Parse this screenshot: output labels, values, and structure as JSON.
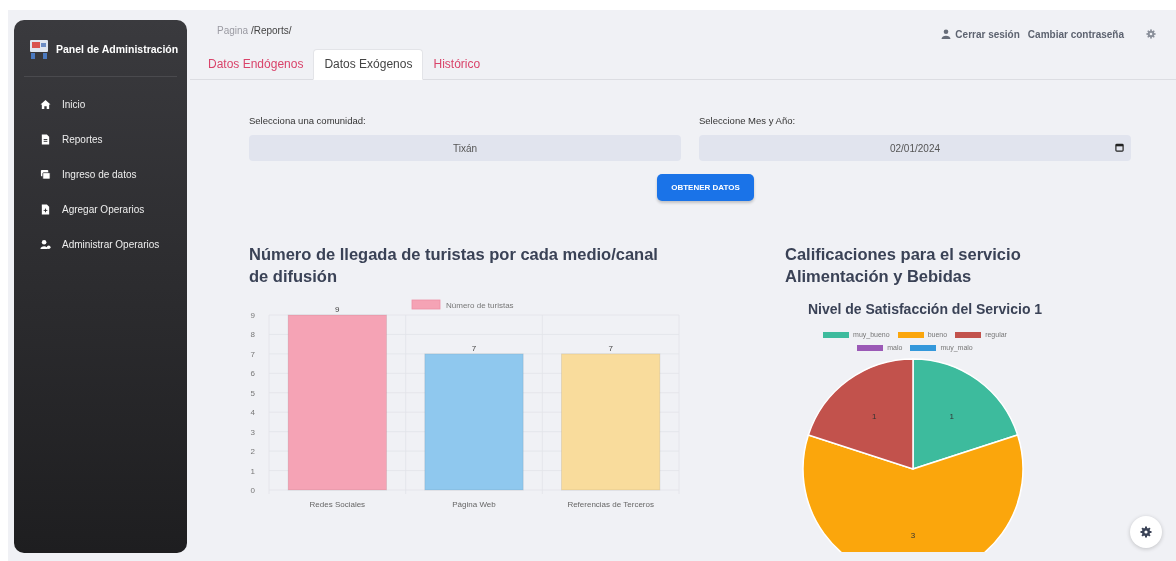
{
  "sidebar": {
    "title": "Panel de Administración",
    "items": [
      {
        "label": "Inicio",
        "kind": "home"
      },
      {
        "label": "Reportes",
        "kind": "file"
      },
      {
        "label": "Ingreso de datos",
        "kind": "stack"
      },
      {
        "label": "Agregar Operarios",
        "kind": "file-plus"
      },
      {
        "label": "Administrar Operarios",
        "kind": "users"
      }
    ]
  },
  "breadcrumb": {
    "prefix": "Pagina",
    "path": "/Reports/"
  },
  "header_links": [
    {
      "label": "Cerrar sesión",
      "kind": "user"
    },
    {
      "label": "Cambiar contraseña",
      "kind": "plain"
    }
  ],
  "tabs": [
    {
      "label": "Datos Endógenos",
      "selected": false
    },
    {
      "label": "Datos Exógenos",
      "selected": true
    },
    {
      "label": "Histórico",
      "selected": false
    }
  ],
  "form": {
    "fields": [
      {
        "label": "Selecciona una comunidad:",
        "value": "Tixán",
        "kind": "select"
      },
      {
        "label": "Seleccione Mes y Año:",
        "value": "02/01/2024",
        "kind": "date"
      }
    ],
    "button": "OBTENER DATOS"
  },
  "charts": [
    {
      "heading": "Número de llegada de turistas por cada medio/canal de difusión",
      "chart_data": {
        "type": "bar",
        "categories": [
          "Redes Sociales",
          "Página Web",
          "Referencias de Terceros"
        ],
        "series": [
          {
            "name": "Número de turistas",
            "color": "#f5a3b5",
            "colors": [
              "#f5a3b5",
              "#8fc8ee",
              "#f9dc9c"
            ],
            "values": [
              9,
              7,
              7
            ]
          }
        ],
        "grid": true,
        "legend": "top",
        "ylim": [
          0,
          9
        ],
        "yticks": [
          0,
          1,
          2,
          3,
          4,
          5,
          6,
          7,
          8,
          9
        ],
        "data_labels": true
      }
    },
    {
      "heading": "Calificaciones para el servicio Alimentación y Bebidas",
      "chart_data": {
        "type": "pie",
        "title": "Nivel de Satisfacción del Servicio 1",
        "categories": [
          "muy_bueno",
          "bueno",
          "regular",
          "malo",
          "muy_malo"
        ],
        "legend": "top",
        "series": [
          {
            "colors": [
              "#3dbb9d",
              "#fba60c",
              "#c2524c",
              "#9b59b6",
              "#3498db"
            ],
            "values": [
              1,
              3,
              1,
              0,
              0
            ]
          }
        ],
        "data_labels": true
      }
    }
  ]
}
